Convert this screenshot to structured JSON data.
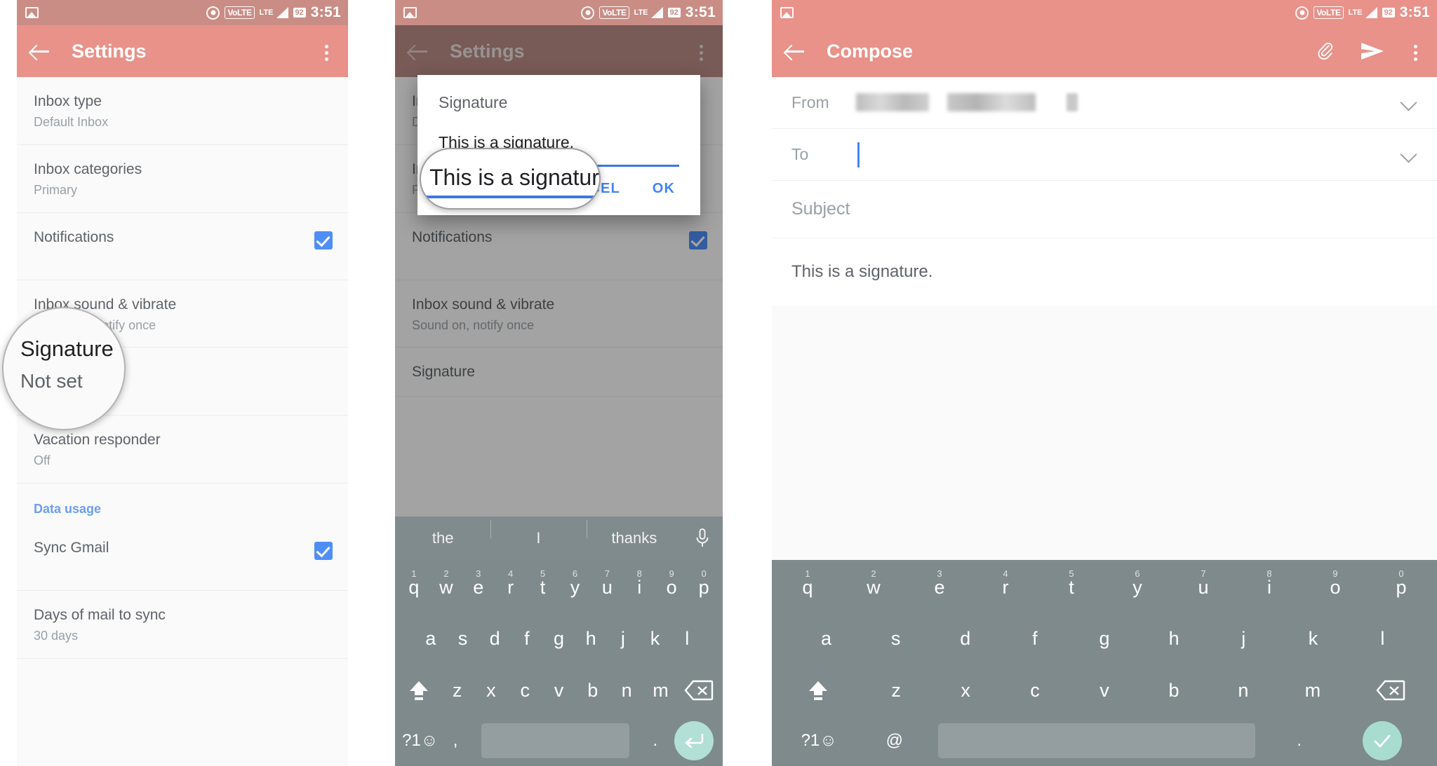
{
  "status_bar": {
    "photo_icon": "photo-icon",
    "cast_icon": "cast-icon",
    "volte": "VoLTE",
    "lte": "LTE",
    "battery": "92",
    "time": "3:51"
  },
  "panel1": {
    "appbar": {
      "title": "Settings",
      "back_icon": "back-arrow-icon",
      "overflow_icon": "kebab-menu-icon"
    },
    "rows": [
      {
        "primary": "Inbox type",
        "secondary": "Default Inbox",
        "checked": false
      },
      {
        "primary": "Inbox categories",
        "secondary": "Primary",
        "checked": false
      },
      {
        "primary": "Notifications",
        "secondary": "",
        "checked": true
      },
      {
        "primary": "Inbox sound & vibrate",
        "secondary": "Sound on, notify once",
        "checked": false
      },
      {
        "primary": "Signature",
        "secondary": "Not set",
        "checked": false
      },
      {
        "primary": "Vacation responder",
        "secondary": "Off",
        "checked": false
      }
    ],
    "section_data_usage": "Data usage",
    "rows2": [
      {
        "primary": "Sync Gmail",
        "secondary": "",
        "checked": true
      },
      {
        "primary": "Days of mail to sync",
        "secondary": "30 days",
        "checked": false
      }
    ],
    "magnifier": {
      "primary": "Signature",
      "secondary": "Not set"
    }
  },
  "panel2": {
    "appbar": {
      "title": "Settings",
      "back_icon": "back-arrow-icon",
      "overflow_icon": "kebab-menu-icon"
    },
    "background_rows": [
      {
        "primary": "Inbox type",
        "secondary": "Default Inbox"
      },
      {
        "primary": "Inbox categories",
        "secondary": "Primary"
      },
      {
        "primary": "Notifications",
        "secondary": ""
      },
      {
        "primary": "Inbox sound & vibrate",
        "secondary": "Sound on, notify once"
      },
      {
        "primary": "Signature",
        "secondary": ""
      }
    ],
    "dialog": {
      "title": "Signature",
      "input_value": "This is a signature.",
      "cancel_label": "CANCEL",
      "ok_label": "OK"
    },
    "magnifier_text": "This is a signature."
  },
  "panel3": {
    "appbar": {
      "title": "Compose",
      "back_icon": "back-arrow-icon",
      "attach_icon": "paperclip-icon",
      "send_icon": "send-icon",
      "overflow_icon": "kebab-menu-icon"
    },
    "from_label": "From",
    "from_value": "",
    "to_label": "To",
    "to_value": "",
    "subject_placeholder": "Subject",
    "body_text": "This is a signature."
  },
  "keyboard": {
    "suggestions": [
      "the",
      "I",
      "thanks"
    ],
    "mic_icon": "microphone-icon",
    "row1": [
      {
        "key": "q",
        "num": "1"
      },
      {
        "key": "w",
        "num": "2"
      },
      {
        "key": "e",
        "num": "3"
      },
      {
        "key": "r",
        "num": "4"
      },
      {
        "key": "t",
        "num": "5"
      },
      {
        "key": "y",
        "num": "6"
      },
      {
        "key": "u",
        "num": "7"
      },
      {
        "key": "i",
        "num": "8"
      },
      {
        "key": "o",
        "num": "9"
      },
      {
        "key": "p",
        "num": "0"
      }
    ],
    "row2": [
      "a",
      "s",
      "d",
      "f",
      "g",
      "h",
      "j",
      "k",
      "l"
    ],
    "row3": [
      "z",
      "x",
      "c",
      "v",
      "b",
      "n",
      "m"
    ],
    "shift_icon": "shift-up-icon",
    "delete_icon": "backspace-icon",
    "sym_key": "?1☺",
    "comma_key": ",",
    "period_key": ".",
    "at_key": "@",
    "enter_icon": "enter-return-icon",
    "done_icon": "checkmark-icon"
  },
  "colors": {
    "accent_pink": "#e8928a",
    "status_pink": "#c98d85",
    "dim_pink": "#b98a84",
    "link_blue": "#4285f4",
    "section_blue": "#6c9ef0",
    "checkbox_blue": "#4f8ef7",
    "keyboard_gray": "#7e8a8c",
    "enter_teal": "#b2dfd6"
  }
}
